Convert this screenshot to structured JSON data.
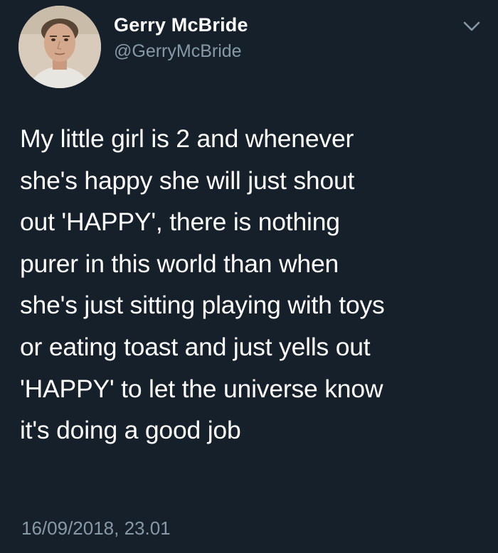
{
  "tweet": {
    "author": {
      "display_name": "Gerry McBride",
      "handle": "@GerryMcBride"
    },
    "text_lines": [
      "My little girl is 2 and whenever",
      "she's happy she will just shout",
      "out 'HAPPY', there is nothing",
      "purer in this world than when",
      "she's just sitting playing with toys",
      "or eating toast and just yells out",
      "'HAPPY' to let the universe know",
      "it's doing a good job"
    ],
    "timestamp": "16/09/2018, 23.01"
  },
  "icons": {
    "menu": "chevron-down-icon",
    "avatar": "profile-photo"
  },
  "colors": {
    "background": "#15202b",
    "primary_text": "#ffffff",
    "secondary_text": "#8899a6"
  }
}
